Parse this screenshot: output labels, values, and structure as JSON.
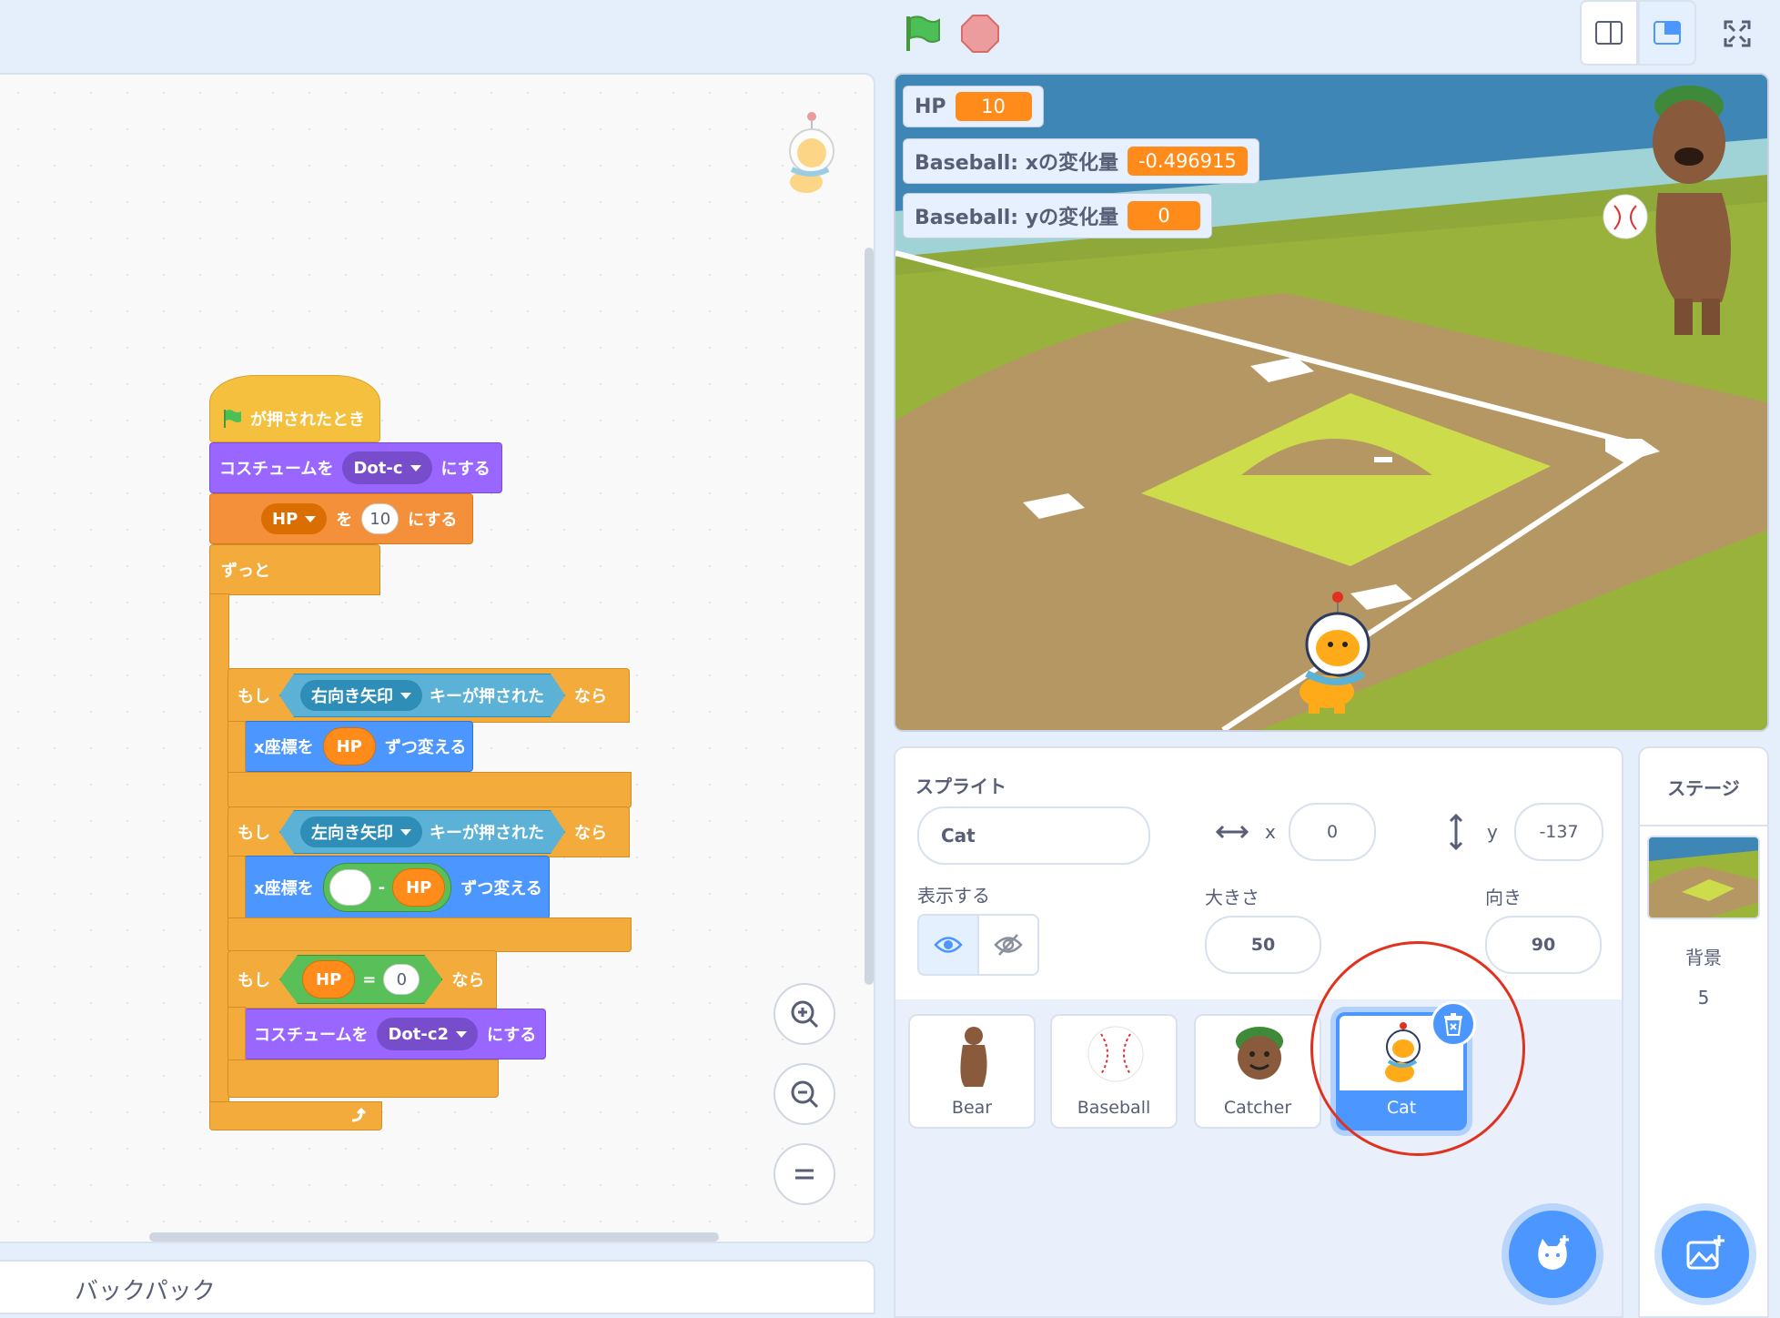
{
  "toolbar": {
    "green_flag": "green-flag-icon",
    "stop": "stop-icon"
  },
  "backpack": {
    "label": "バックパック"
  },
  "script": {
    "hat_label": "が押されたとき",
    "switch_costume_1": {
      "prefix": "コスチュームを",
      "value": "Dot-c",
      "suffix": "にする"
    },
    "set_var": {
      "var": "HP",
      "mid": "を",
      "value": "10",
      "suffix": "にする"
    },
    "forever": "ずっと",
    "if1": {
      "prefix": "もし",
      "key": "右向き矢印",
      "cond": "キーが押された",
      "suffix": "なら"
    },
    "change_x1": {
      "prefix": "x座標を",
      "reporter": "HP",
      "suffix": "ずつ変える"
    },
    "if2": {
      "prefix": "もし",
      "key": "左向き矢印",
      "cond": "キーが押された",
      "suffix": "なら"
    },
    "change_x2": {
      "prefix": "x座標を",
      "op": "-",
      "reporter": "HP",
      "suffix": "ずつ変える"
    },
    "if3": {
      "prefix": "もし",
      "reporter": "HP",
      "op": "=",
      "value": "0",
      "suffix": "なら"
    },
    "switch_costume_2": {
      "prefix": "コスチュームを",
      "value": "Dot-c2",
      "suffix": "にする"
    }
  },
  "monitors": [
    {
      "label": "HP",
      "value": "10"
    },
    {
      "label": "Baseball: xの変化量",
      "value": "-0.496915"
    },
    {
      "label": "Baseball: yの変化量",
      "value": "0"
    }
  ],
  "sprite_info": {
    "sprite_label": "スプライト",
    "sprite_name": "Cat",
    "x_label": "x",
    "x_value": "0",
    "y_label": "y",
    "y_value": "-137",
    "show_label": "表示する",
    "size_label": "大きさ",
    "size_value": "50",
    "direction_label": "向き",
    "direction_value": "90"
  },
  "sprites": [
    {
      "name": "Bear",
      "selected": false
    },
    {
      "name": "Baseball",
      "selected": false
    },
    {
      "name": "Catcher",
      "selected": false
    },
    {
      "name": "Cat",
      "selected": true
    }
  ],
  "stage_pane": {
    "label": "ステージ",
    "backdrop_label": "背景",
    "backdrop_count": "5"
  },
  "colors": {
    "accent": "#4c97ff",
    "highlight_circle": "#e0321f"
  }
}
